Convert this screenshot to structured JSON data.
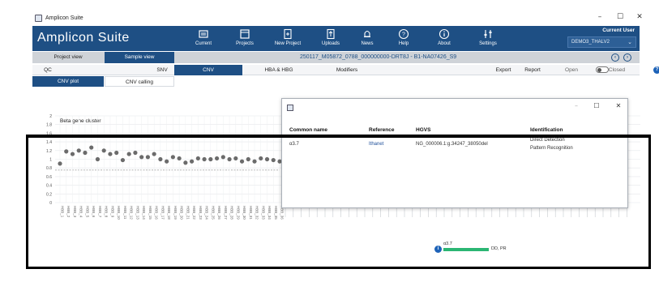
{
  "window": {
    "title": "Amplicon Suite",
    "controls": [
      "–",
      "☐",
      "✕"
    ]
  },
  "header": {
    "brand": "Amplicon Suite",
    "nav": [
      {
        "label": "Current",
        "icon": "current-icon"
      },
      {
        "label": "Projects",
        "icon": "projects-icon"
      },
      {
        "label": "New Project",
        "icon": "new-project-icon"
      },
      {
        "label": "Uploads",
        "icon": "uploads-icon"
      },
      {
        "label": "News",
        "icon": "bell-icon"
      },
      {
        "label": "Help",
        "icon": "help-icon"
      },
      {
        "label": "About",
        "icon": "info-icon"
      },
      {
        "label": "Settings",
        "icon": "settings-icon"
      }
    ],
    "user_title": "Current User",
    "user_value": "DEMO3_THALV2"
  },
  "view_tabs": {
    "project_view": "Project view",
    "sample_view": "Sample view"
  },
  "breadcrumb": "250117_M05872_0788_000000000-DRT8J - B1-NA07426_S9",
  "sections": {
    "qc": "QC",
    "snv": "SNV",
    "cnv": "CNV",
    "hba_hbg": "HBA & HBG",
    "modifiers": "Modifiers",
    "export": "Export",
    "report": "Report",
    "open": "Open",
    "closed": "Closed"
  },
  "sub_tabs": {
    "cnv_plot": "CNV plot",
    "cnv_calling": "CNV calling"
  },
  "chart_data": {
    "type": "scatter",
    "title": "Beta gene cluster",
    "ylim": [
      0,
      2
    ],
    "yticks": [
      "0",
      "0.2",
      "0.4",
      "0.6",
      "0.8",
      "1",
      "1.2",
      "1.4",
      "1.6",
      "1.8",
      "2"
    ],
    "threshold": 0.75,
    "categories": [
      "HBB_1",
      "HBB_2",
      "HBB_3",
      "HBB_4",
      "HBB_5",
      "HBB_6",
      "HBB_7",
      "HBB_8",
      "HBB_9",
      "HBB_10",
      "HBB_11",
      "HBB_12",
      "HBB_13",
      "HBB_14",
      "HBB_15",
      "HBB_16",
      "HBB_17",
      "HBB_18",
      "HBB_19",
      "HBB_20",
      "HBB_21",
      "HBB_22",
      "HBB_23",
      "HBB_24",
      "HBB_25",
      "HBB_26",
      "HBB_27",
      "HBB_28",
      "HBB_29",
      "HBB_30",
      "HBB_31",
      "HBB_32",
      "HBB_33",
      "HBB_34",
      "HBB_35",
      "HBB_36"
    ],
    "values": [
      0.9,
      1.18,
      1.12,
      1.2,
      1.15,
      1.27,
      1.0,
      1.2,
      1.12,
      1.15,
      0.98,
      1.12,
      1.15,
      1.05,
      1.05,
      1.12,
      1.0,
      0.95,
      1.05,
      1.02,
      0.92,
      0.95,
      1.02,
      1.0,
      1.0,
      1.02,
      1.05,
      1.0,
      1.02,
      0.95,
      1.0,
      0.95,
      1.02,
      1.0,
      0.98,
      0.95
    ],
    "grid": true
  },
  "modal": {
    "controls": [
      "–",
      "☐",
      "✕"
    ],
    "headers": {
      "common_name": "Common name",
      "reference": "Reference",
      "hgvs": "HGVS",
      "identification": "Identification"
    },
    "row": {
      "common_name": "α3.7",
      "reference": "Ithanet",
      "hgvs": "NG_000006.1:g.34247_38050del",
      "identification_1": "Direct Detection",
      "identification_2": "Pattern Recognition"
    }
  },
  "legend": {
    "label": "α3.7",
    "value": "DD, PR",
    "color": "#2bb673"
  },
  "colors": {
    "header": "#1e4f84",
    "accent": "#1e63b8",
    "tab_active": "#1e4f84"
  }
}
